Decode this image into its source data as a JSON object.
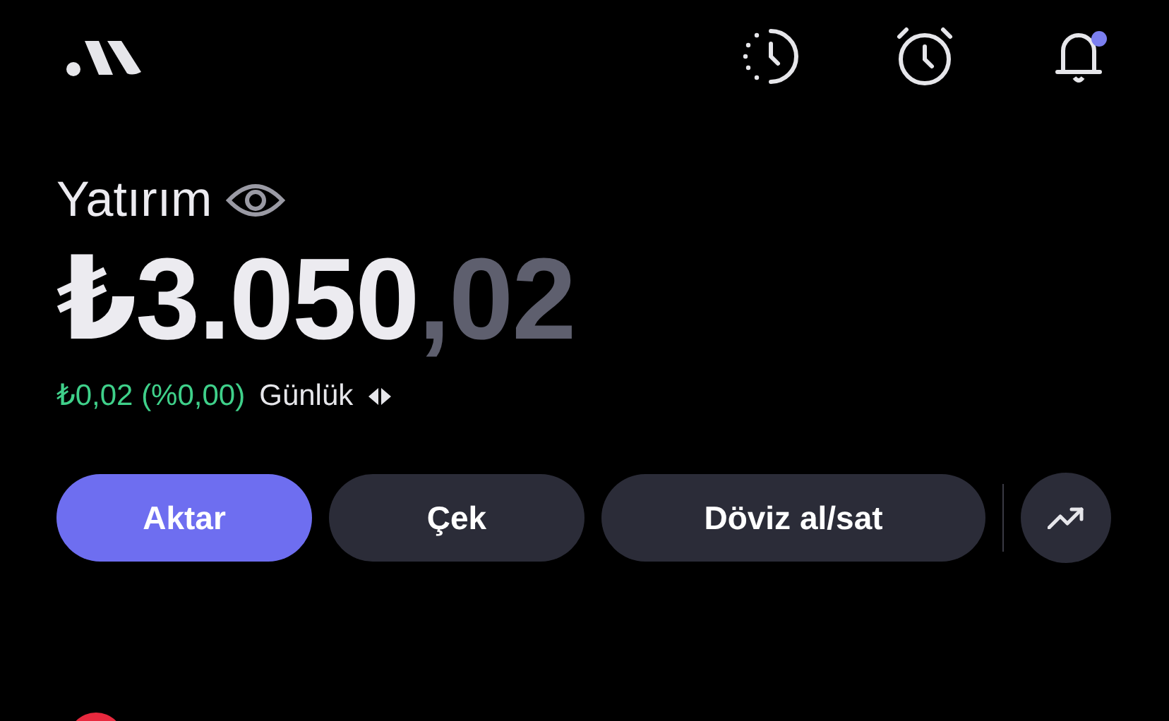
{
  "header": {
    "notifications_unread": true
  },
  "account": {
    "title": "Yatırım",
    "balance_whole": "₺3.050",
    "balance_decimal": ",02",
    "change": "₺0,02 (%0,00)",
    "period": "Günlük"
  },
  "actions": [
    {
      "kind": "primary",
      "label": "Aktar"
    },
    {
      "kind": "secondary",
      "label": "Çek"
    },
    {
      "kind": "secondary",
      "label": "Döviz al/sat"
    },
    {
      "kind": "icon"
    }
  ]
}
